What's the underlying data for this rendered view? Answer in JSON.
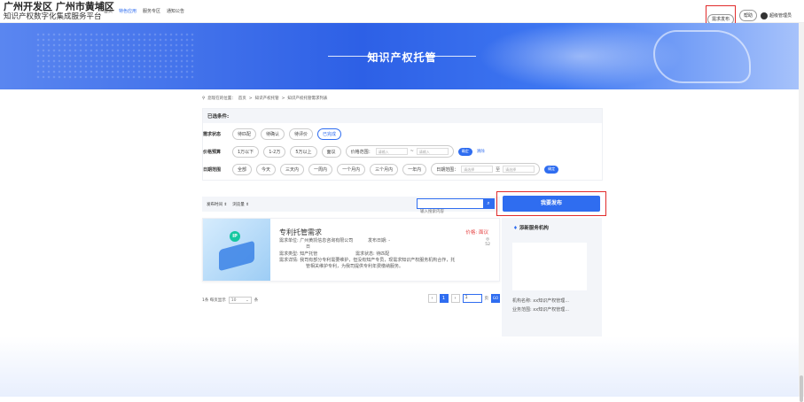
{
  "brand": {
    "line1": "广州开发区 广州市黄埔区",
    "line2": "知识产权数字化集成服务平台"
  },
  "nav": [
    {
      "label": "首页",
      "active": false
    },
    {
      "label": "特色应用",
      "active": true
    },
    {
      "label": "服务专区",
      "active": false
    },
    {
      "label": "通知公告",
      "active": false
    }
  ],
  "topright": {
    "publish": "需求发布",
    "help": "帮助",
    "user": "超级管理员"
  },
  "banner": {
    "title": "知识产权托管"
  },
  "crumb": {
    "prefix": "您现在的位置：",
    "items": [
      "首页",
      ">",
      "知识产权托管",
      ">",
      "知识产权托管需求列表"
    ]
  },
  "filter": {
    "header": "已选条件:",
    "status": {
      "label": "需求状态",
      "options": [
        "待匹配",
        "待确认",
        "待评价",
        "已完成"
      ],
      "selected": "已完成"
    },
    "price": {
      "label": "价格预算",
      "options": [
        "1万以下",
        "1-2万",
        "5万以上",
        "面议"
      ],
      "range_label": "价格范围：",
      "placeholder_min": "请输入",
      "sep": "~",
      "placeholder_max": "请输入",
      "confirm": "确定",
      "clear": "清除"
    },
    "date": {
      "label": "日期范围",
      "options": [
        "全部",
        "今天",
        "三天内",
        "一周内",
        "一个月内",
        "三个月内",
        "一年内"
      ],
      "range_label": "日期范围：",
      "placeholder_start": "请选择",
      "sep": "至",
      "placeholder_end": "请选择",
      "confirm": "确定"
    }
  },
  "sort": {
    "by_time": "发布时间 ⇕",
    "by_views": "浏览量 ⇕",
    "search_placeholder": "输入搜索内容"
  },
  "publish_button": "我要发布",
  "card": {
    "title": "专利托管需求",
    "price": "价格: 面议",
    "unit_label": "需求单位: 广州黄凯信息咨询有限公司",
    "date_label": "发布日期: -",
    "date_cont": "日",
    "type": "需求类型: 知产托管",
    "status": "需求状态: 待匹配",
    "detail1": "需求详情: 我司有部分专利需要维护，但没有知产专员，现需求知识产权服务机构合作，托",
    "detail2": "管相关维护专利，为我司提供专利年费缴纳服务。",
    "views_icon": "◎",
    "views": "52"
  },
  "pager": {
    "total": "1条 每页显示",
    "per_page": "10",
    "unit": "条",
    "current": "1",
    "page_input": "1",
    "page_suffix": "页",
    "go": "GO"
  },
  "side": {
    "title": "添新服务机构",
    "org_name": "机构名称: xx知识产权管理...",
    "business": "业务范围: xx知识产权管理..."
  }
}
